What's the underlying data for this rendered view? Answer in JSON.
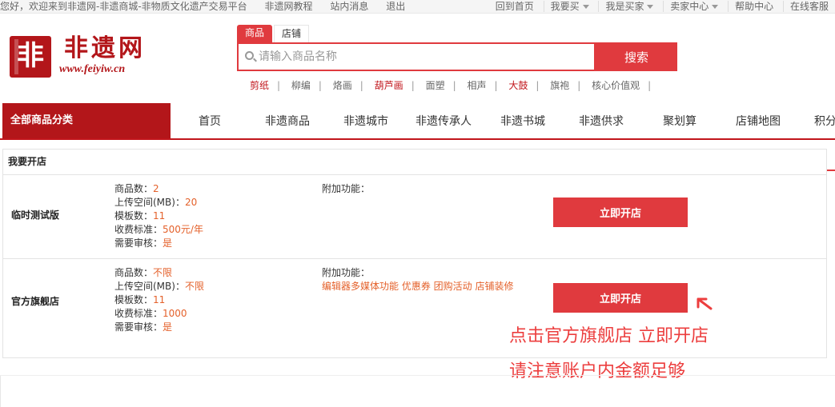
{
  "topbar": {
    "welcome": "您好，欢迎来到非遗网-非遗商城-非物质文化遗产交易平台",
    "tutorial": "非遗网教程",
    "messages": "站内消息",
    "logout": "退出",
    "home": "回到首页",
    "buy": "我要买",
    "buyer": "我是买家",
    "seller": "卖家中心",
    "help": "帮助中心",
    "service": "在线客服"
  },
  "logo": {
    "mark": "非",
    "name": "非遗网",
    "url": "www.feiyiw.cn"
  },
  "search": {
    "tab_goods": "商品",
    "tab_shops": "店铺",
    "placeholder": "请输入商品名称",
    "button": "搜索",
    "hot_words": [
      "剪纸",
      "柳编",
      "烙画",
      "葫芦画",
      "面塑",
      "相声",
      "大鼓",
      "旗袍",
      "核心价值观"
    ]
  },
  "nav": {
    "all_categories": "全部商品分类",
    "items": [
      "首页",
      "非遗商品",
      "非遗城市",
      "非遗传承人",
      "非遗书城",
      "非遗供求",
      "聚划算",
      "店铺地图",
      "积分"
    ]
  },
  "panel": {
    "title": "我要开店",
    "plans": [
      {
        "name": "临时测试版",
        "goods_label": "商品数：",
        "goods_value": "2",
        "space_label": "上传空间(MB)：",
        "space_value": "20",
        "templates_label": "模板数：",
        "templates_value": "11",
        "fee_label": "收费标准：",
        "fee_value": "500元/年",
        "review_label": "需要审核：",
        "review_value": "是",
        "extra_label": "附加功能：",
        "extra_value": "",
        "button": "立即开店"
      },
      {
        "name": "官方旗舰店",
        "goods_label": "商品数：",
        "goods_value": "不限",
        "space_label": "上传空间(MB)：",
        "space_value": "不限",
        "templates_label": "模板数：",
        "templates_value": "11",
        "fee_label": "收费标准：",
        "fee_value": "1000",
        "review_label": "需要审核：",
        "review_value": "是",
        "extra_label": "附加功能：",
        "extra_value": "编辑器多媒体功能 优惠券 团购活动 店铺装修",
        "button": "立即开店"
      }
    ]
  },
  "annotation": {
    "line1": "点击官方旗舰店  立即开店",
    "line2": "请注意账户内金额足够"
  },
  "colors": {
    "brand_red": "#b3161a",
    "button_red": "#e03a3e",
    "value_orange": "#e4612b",
    "note_red": "#ec3e3e"
  }
}
